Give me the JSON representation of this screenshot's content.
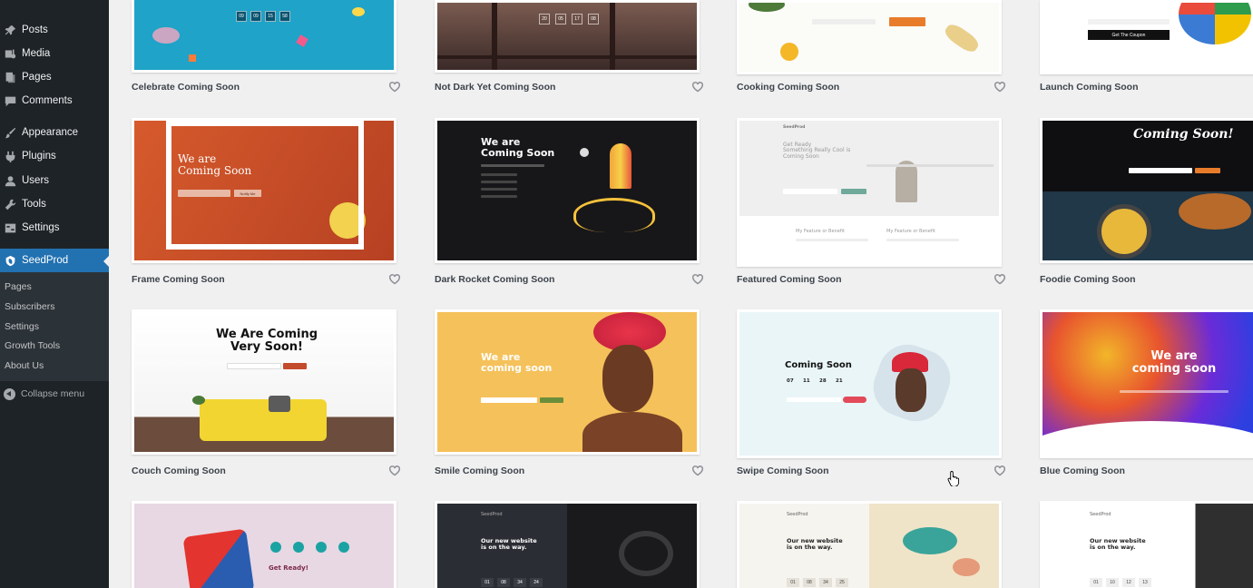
{
  "sidebar": {
    "items": [
      {
        "label": "Posts",
        "icon": "pin-icon"
      },
      {
        "label": "Media",
        "icon": "media-icon"
      },
      {
        "label": "Pages",
        "icon": "pages-icon"
      },
      {
        "label": "Comments",
        "icon": "comments-icon"
      },
      {
        "label": "Appearance",
        "icon": "brush-icon"
      },
      {
        "label": "Plugins",
        "icon": "plug-icon"
      },
      {
        "label": "Users",
        "icon": "users-icon"
      },
      {
        "label": "Tools",
        "icon": "wrench-icon"
      },
      {
        "label": "Settings",
        "icon": "settings-icon"
      },
      {
        "label": "SeedProd",
        "icon": "seedprod-icon",
        "active": true
      }
    ],
    "submenu": [
      "Pages",
      "Subscribers",
      "Settings",
      "Growth Tools",
      "About Us"
    ],
    "collapse_label": "Collapse menu"
  },
  "templates": [
    {
      "title": "Celebrate Coming Soon",
      "countdown": [
        "09",
        "09",
        "15",
        "58"
      ]
    },
    {
      "title": "Not Dark Yet Coming Soon",
      "countdown": [
        "20",
        "05",
        "17",
        "08"
      ]
    },
    {
      "title": "Cooking Coming Soon"
    },
    {
      "title": "Launch Coming Soon",
      "button": "Get The Coupon"
    },
    {
      "title": "Frame Coming Soon",
      "heading": "We are\nComing Soon",
      "button": "Notify Me"
    },
    {
      "title": "Dark Rocket Coming Soon",
      "heading": "We are\nComing Soon"
    },
    {
      "title": "Featured Coming Soon",
      "heading": "Get Ready\nSomething Really Cool is\nComing Soon",
      "features": [
        "My Feature or Benefit",
        "My Feature or Benefit"
      ],
      "logo": "SeedProd"
    },
    {
      "title": "Foodie Coming Soon",
      "heading": "Coming Soon!"
    },
    {
      "title": "Couch Coming Soon",
      "heading": "We Are Coming\nVery Soon!"
    },
    {
      "title": "Smile Coming Soon",
      "heading": "We are\ncoming soon"
    },
    {
      "title": "Swipe Coming Soon",
      "heading": "Coming Soon",
      "countdown": [
        "07",
        "11",
        "28",
        "21"
      ]
    },
    {
      "title": "Blue Coming Soon",
      "heading": "We are\ncoming soon"
    },
    {
      "title": "",
      "heading": "Get Ready!"
    },
    {
      "title": "",
      "heading": "Our new website\nis on the way.",
      "countdown": [
        "01",
        "08",
        "34",
        "24"
      ],
      "logo": "SeedProd"
    },
    {
      "title": "",
      "heading": "Our new website\nis on the way.",
      "countdown": [
        "01",
        "08",
        "34",
        "25"
      ],
      "logo": "SeedProd"
    },
    {
      "title": "",
      "heading": "Our new website\nis on the way.",
      "countdown": [
        "01",
        "10",
        "12",
        "13"
      ],
      "logo": "SeedProd"
    }
  ]
}
